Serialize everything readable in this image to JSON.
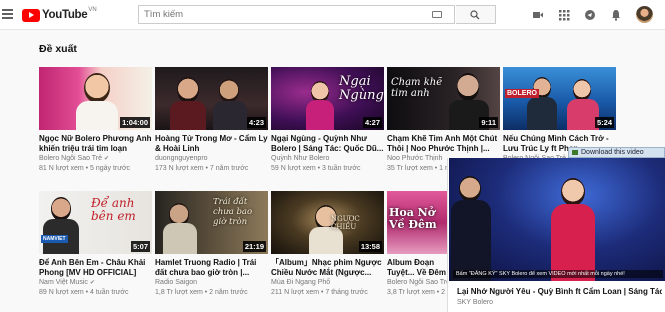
{
  "header": {
    "logo_text": "YouTube",
    "region": "VN",
    "search_placeholder": "Tìm kiếm",
    "icons": [
      "menu-icon",
      "keyboard-icon",
      "search-icon",
      "video-camera-icon",
      "apps-grid-icon",
      "messages-icon",
      "bell-icon",
      "avatar"
    ]
  },
  "section": {
    "title": "Đề xuất"
  },
  "videos": [
    {
      "title": "Ngọc Nữ Bolero Phương Anh khiến triệu trái tim loạn nhịp...",
      "channel": "Bolero Ngôi Sao Trẻ",
      "meta": "81 N lượt xem • 5 ngày trước",
      "duration": "1:04:00"
    },
    {
      "title": "Hoàng Tử Trong Mơ - Cẩm Ly & Hoài Linh",
      "channel": "duongnguyenpro",
      "meta": "173 N lượt xem • 7 năm trước",
      "duration": "4:23"
    },
    {
      "title": "Ngại Ngùng - Quỳnh Như Bolero | Sáng Tác: Quốc Dũ...",
      "channel": "Quỳnh Như Bolero",
      "meta": "59 N lượt xem • 3 tuần trước",
      "duration": "4:27",
      "overlay": "Ngại Ngùng"
    },
    {
      "title": "Chạm Khẽ Tim Anh Một Chút Thôi | Noo Phước Thịnh |...",
      "channel": "Noo Phước Thịnh",
      "meta": "35 Tr lượt xem • 1 năm trước",
      "duration": "9:11",
      "overlay": "Chạm khẽ tim anh"
    },
    {
      "title": "Nếu Chúng Mình Cách Trở - Lưu Trúc Ly ft Phan...",
      "channel": "Bolero Ngôi Sao Trẻ",
      "meta": "",
      "duration": "5:24",
      "overlay": "BOLERO"
    },
    {
      "title": "Để Anh Bên Em - Châu Khải Phong [MV HD OFFICIAL]",
      "channel": "Nam Việt Music",
      "meta": "89 N lượt xem • 4 tuần trước",
      "duration": "5:07",
      "overlay": "Để anh bên em"
    },
    {
      "title": "Hamlet Truong Radio | Trái đất chưa bao giờ tròn |...",
      "channel": "Radio Saigon",
      "meta": "1,8 Tr lượt xem • 2 năm trước",
      "duration": "21:19",
      "overlay": "Trái đất chưa bao giờ tròn"
    },
    {
      "title": "「Album」Nhạc phim Ngược Chiều Nước Mắt (Ngược...",
      "channel": "Mùa Đi Ngang Phố",
      "meta": "211 N lượt xem • 7 tháng trước",
      "duration": "13:58",
      "overlay": "NGƯỢC CHIỀU"
    },
    {
      "title": "Album Đoạn Tuyệt... Về Đêm - Phương...",
      "channel": "Bolero Ngôi Sao Trẻ",
      "meta": "3,8 Tr lượt xem • 2 năm...",
      "duration": "",
      "overlay": "Hoa Nở Về Đêm"
    }
  ],
  "miniplayer": {
    "title": "Lại Nhớ Người Yêu - Quỳ Bình ft Cẩm Loan | Sáng Tác: Gi...",
    "channel": "SKY Bolero",
    "caption": "Bấm \"ĐĂNG KÝ\" SKY Bolero để xem VIDEO mới nhất mỗi ngày nhé!",
    "download_label": "Download this video"
  }
}
